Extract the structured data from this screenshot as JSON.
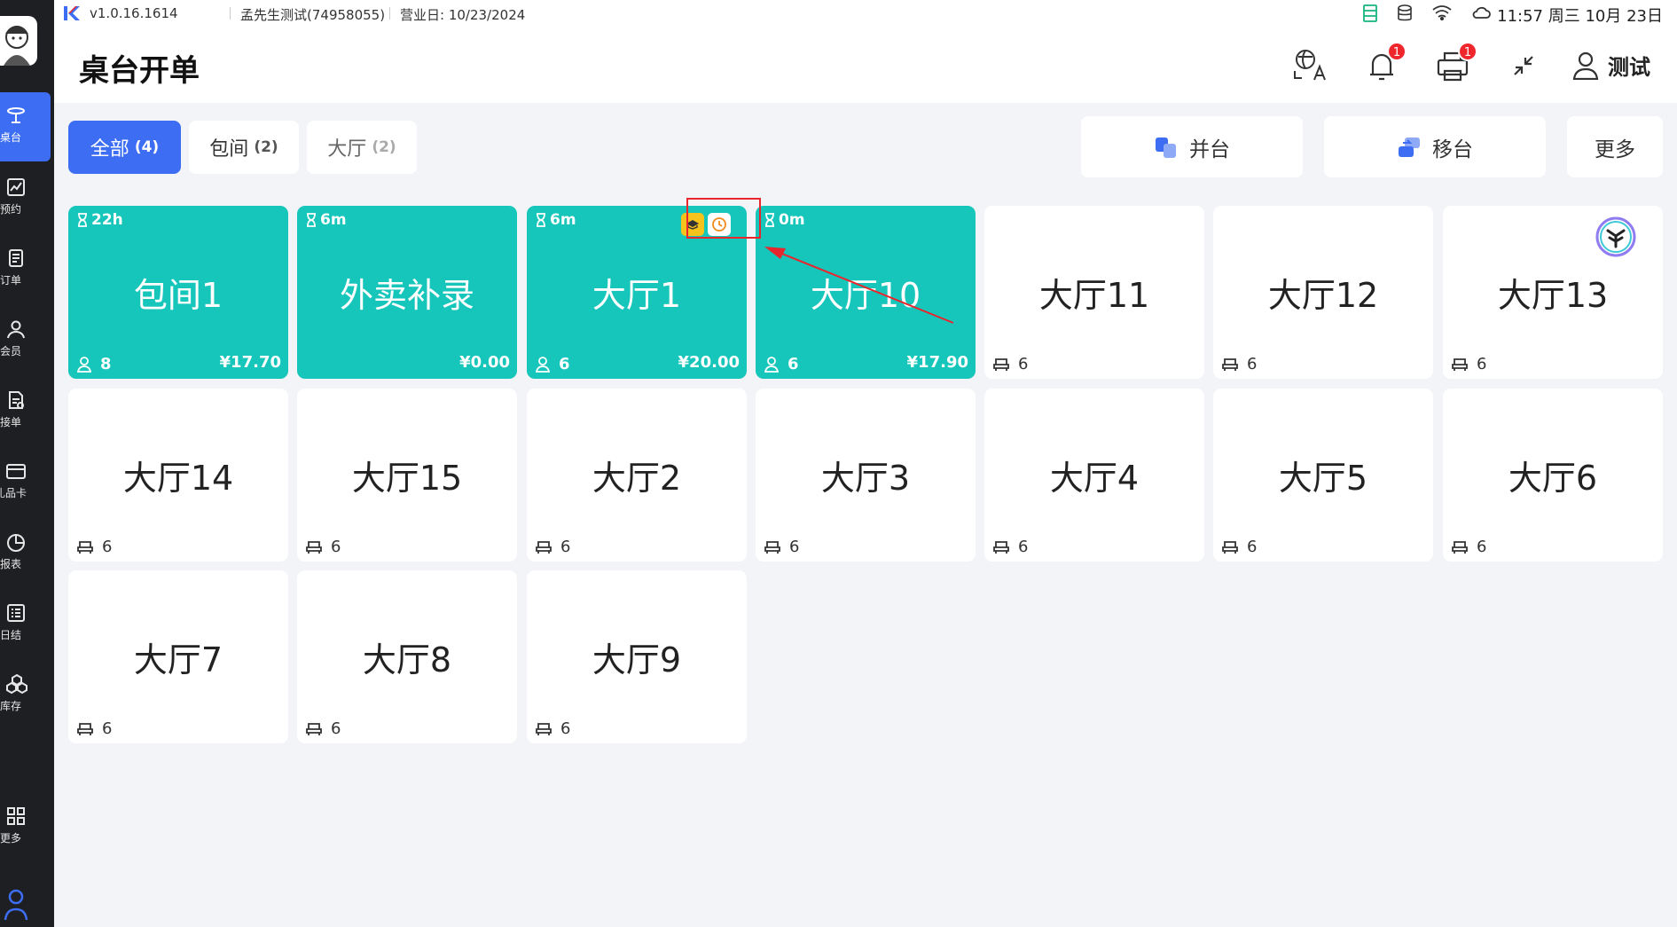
{
  "status_bar": {
    "version": "v1.0.16.1614",
    "store": "孟先生测试(74958055)",
    "business_date": "营业日: 10/23/2024",
    "clock": "11:57 周三 10月 23日"
  },
  "sidebar": {
    "items": [
      {
        "label": "桌台",
        "icon": "table-icon",
        "active": true
      },
      {
        "label": "预约",
        "icon": "reservation-icon",
        "active": false
      },
      {
        "label": "订单",
        "icon": "order-icon",
        "active": false
      },
      {
        "label": "会员",
        "icon": "member-icon",
        "active": false
      },
      {
        "label": "接单",
        "icon": "receive-order-icon",
        "active": false
      },
      {
        "label": "礼品卡",
        "icon": "gift-card-icon",
        "active": false
      },
      {
        "label": "报表",
        "icon": "report-icon",
        "active": false
      },
      {
        "label": "日结",
        "icon": "daily-close-icon",
        "active": false
      },
      {
        "label": "库存",
        "icon": "inventory-icon",
        "active": false
      },
      {
        "label": "更多",
        "icon": "more-grid-icon",
        "active": false
      }
    ]
  },
  "header": {
    "title": "桌台开单",
    "notification_badge": "1",
    "print_badge": "1",
    "username": "测试"
  },
  "tabs": [
    {
      "label": "全部",
      "count": "(4)",
      "active": true
    },
    {
      "label": "包间",
      "count": "(2)",
      "active": false
    },
    {
      "label": "大厅",
      "count": "(2)",
      "active": false
    }
  ],
  "actions": {
    "merge_label": "并台",
    "move_label": "移台",
    "more_label": "更多"
  },
  "tables": [
    {
      "name": "包间1",
      "busy": true,
      "timer": "22h",
      "people": "8",
      "amount": "¥17.70"
    },
    {
      "name": "外卖补录",
      "busy": true,
      "timer": "6m",
      "people": "",
      "amount": "¥0.00"
    },
    {
      "name": "大厅1",
      "busy": true,
      "timer": "6m",
      "people": "6",
      "amount": "¥20.00"
    },
    {
      "name": "大厅10",
      "busy": true,
      "timer": "0m",
      "people": "6",
      "amount": "¥17.90"
    },
    {
      "name": "大厅11",
      "busy": false,
      "seats": "6"
    },
    {
      "name": "大厅12",
      "busy": false,
      "seats": "6"
    },
    {
      "name": "大厅13",
      "busy": false,
      "seats": "6"
    },
    {
      "name": "大厅14",
      "busy": false,
      "seats": "6"
    },
    {
      "name": "大厅15",
      "busy": false,
      "seats": "6"
    },
    {
      "name": "大厅2",
      "busy": false,
      "seats": "6"
    },
    {
      "name": "大厅3",
      "busy": false,
      "seats": "6"
    },
    {
      "name": "大厅4",
      "busy": false,
      "seats": "6"
    },
    {
      "name": "大厅5",
      "busy": false,
      "seats": "6"
    },
    {
      "name": "大厅6",
      "busy": false,
      "seats": "6"
    },
    {
      "name": "大厅7",
      "busy": false,
      "seats": "6"
    },
    {
      "name": "大厅8",
      "busy": false,
      "seats": "6"
    },
    {
      "name": "大厅9",
      "busy": false,
      "seats": "6"
    }
  ],
  "colors": {
    "accent": "#3d6df2",
    "busy_table": "#17c6bb",
    "sidebar_bg": "#1e1f23",
    "badge_red": "#f0262d",
    "highlight_red": "#e8262d"
  }
}
